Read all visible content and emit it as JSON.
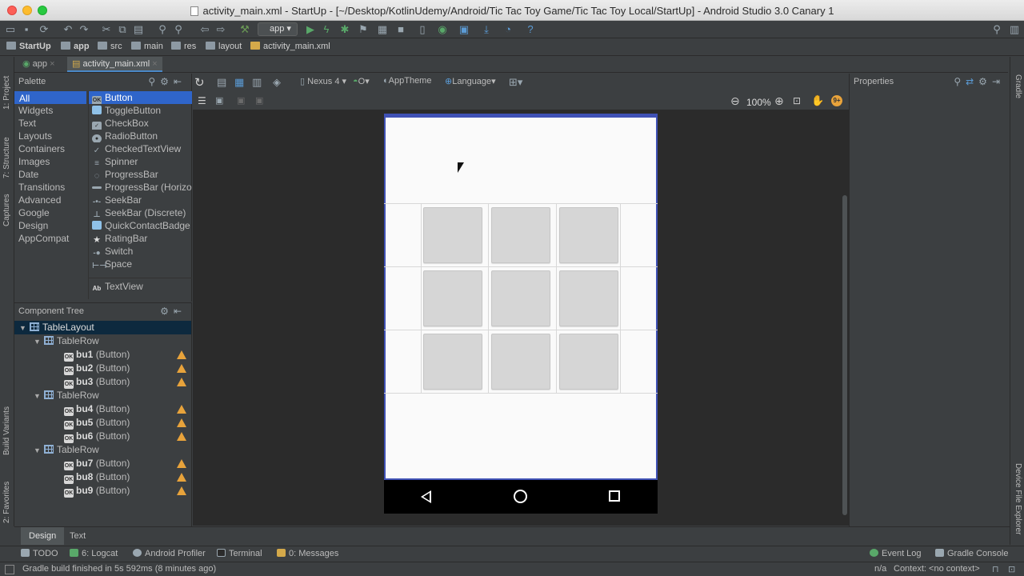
{
  "window": {
    "title": "activity_main.xml - StartUp - [~/Desktop/KotlinUdemy/Android/Tic Tac Toy Game/Tic Tac Toy Local/StartUp] - Android Studio 3.0 Canary 1"
  },
  "toolbar": {
    "run_config": "app"
  },
  "breadcrumbs": [
    "StartUp",
    "app",
    "src",
    "main",
    "res",
    "layout",
    "activity_main.xml"
  ],
  "editor_tabs": [
    {
      "label": "app",
      "active": false
    },
    {
      "label": "activity_main.xml",
      "active": true
    }
  ],
  "left_tool_strip": [
    "1: Project",
    "7: Structure",
    "Captures",
    "Build Variants",
    "2: Favorites"
  ],
  "right_tool_strip": [
    "Gradle",
    "Device File Explorer"
  ],
  "palette": {
    "title": "Palette",
    "categories": [
      "All",
      "Widgets",
      "Text",
      "Layouts",
      "Containers",
      "Images",
      "Date",
      "Transitions",
      "Advanced",
      "Google",
      "Design",
      "AppCompat"
    ],
    "widgets": [
      "Button",
      "ToggleButton",
      "CheckBox",
      "RadioButton",
      "CheckedTextView",
      "Spinner",
      "ProgressBar",
      "ProgressBar (Horizo",
      "SeekBar",
      "SeekBar (Discrete)",
      "QuickContactBadge",
      "RatingBar",
      "Switch",
      "Space"
    ],
    "text_widget": "TextView"
  },
  "design_toolbar": {
    "device": "Nexus 4",
    "api": "O",
    "theme": "AppTheme",
    "language": "Language",
    "zoom": "100%"
  },
  "component_tree": {
    "title": "Component Tree",
    "root": "TableLayout",
    "rows": [
      {
        "label": "TableRow",
        "buttons": [
          {
            "id": "bu1",
            "type": "(Button)"
          },
          {
            "id": "bu2",
            "type": "(Button)"
          },
          {
            "id": "bu3",
            "type": "(Button)"
          }
        ]
      },
      {
        "label": "TableRow",
        "buttons": [
          {
            "id": "bu4",
            "type": "(Button)"
          },
          {
            "id": "bu5",
            "type": "(Button)"
          },
          {
            "id": "bu6",
            "type": "(Button)"
          }
        ]
      },
      {
        "label": "TableRow",
        "buttons": [
          {
            "id": "bu7",
            "type": "(Button)"
          },
          {
            "id": "bu8",
            "type": "(Button)"
          },
          {
            "id": "bu9",
            "type": "(Button)"
          }
        ]
      }
    ]
  },
  "properties": {
    "title": "Properties"
  },
  "mode_tabs": [
    "Design",
    "Text"
  ],
  "tool_windows": {
    "left": [
      "TODO",
      "6: Logcat",
      "Android Profiler",
      "Terminal",
      "0: Messages"
    ],
    "right": [
      "Event Log",
      "Gradle Console"
    ]
  },
  "status": {
    "message": "Gradle build finished in 5s 592ms (8 minutes ago)",
    "position": "n/a",
    "context": "Context: <no context>"
  },
  "colors": {
    "ide_bg": "#3c3f41",
    "canvas_bg": "#2b2b2b",
    "selection": "#2f65ca",
    "app_bar": "#3f51b5",
    "warning": "#e8a33b"
  }
}
